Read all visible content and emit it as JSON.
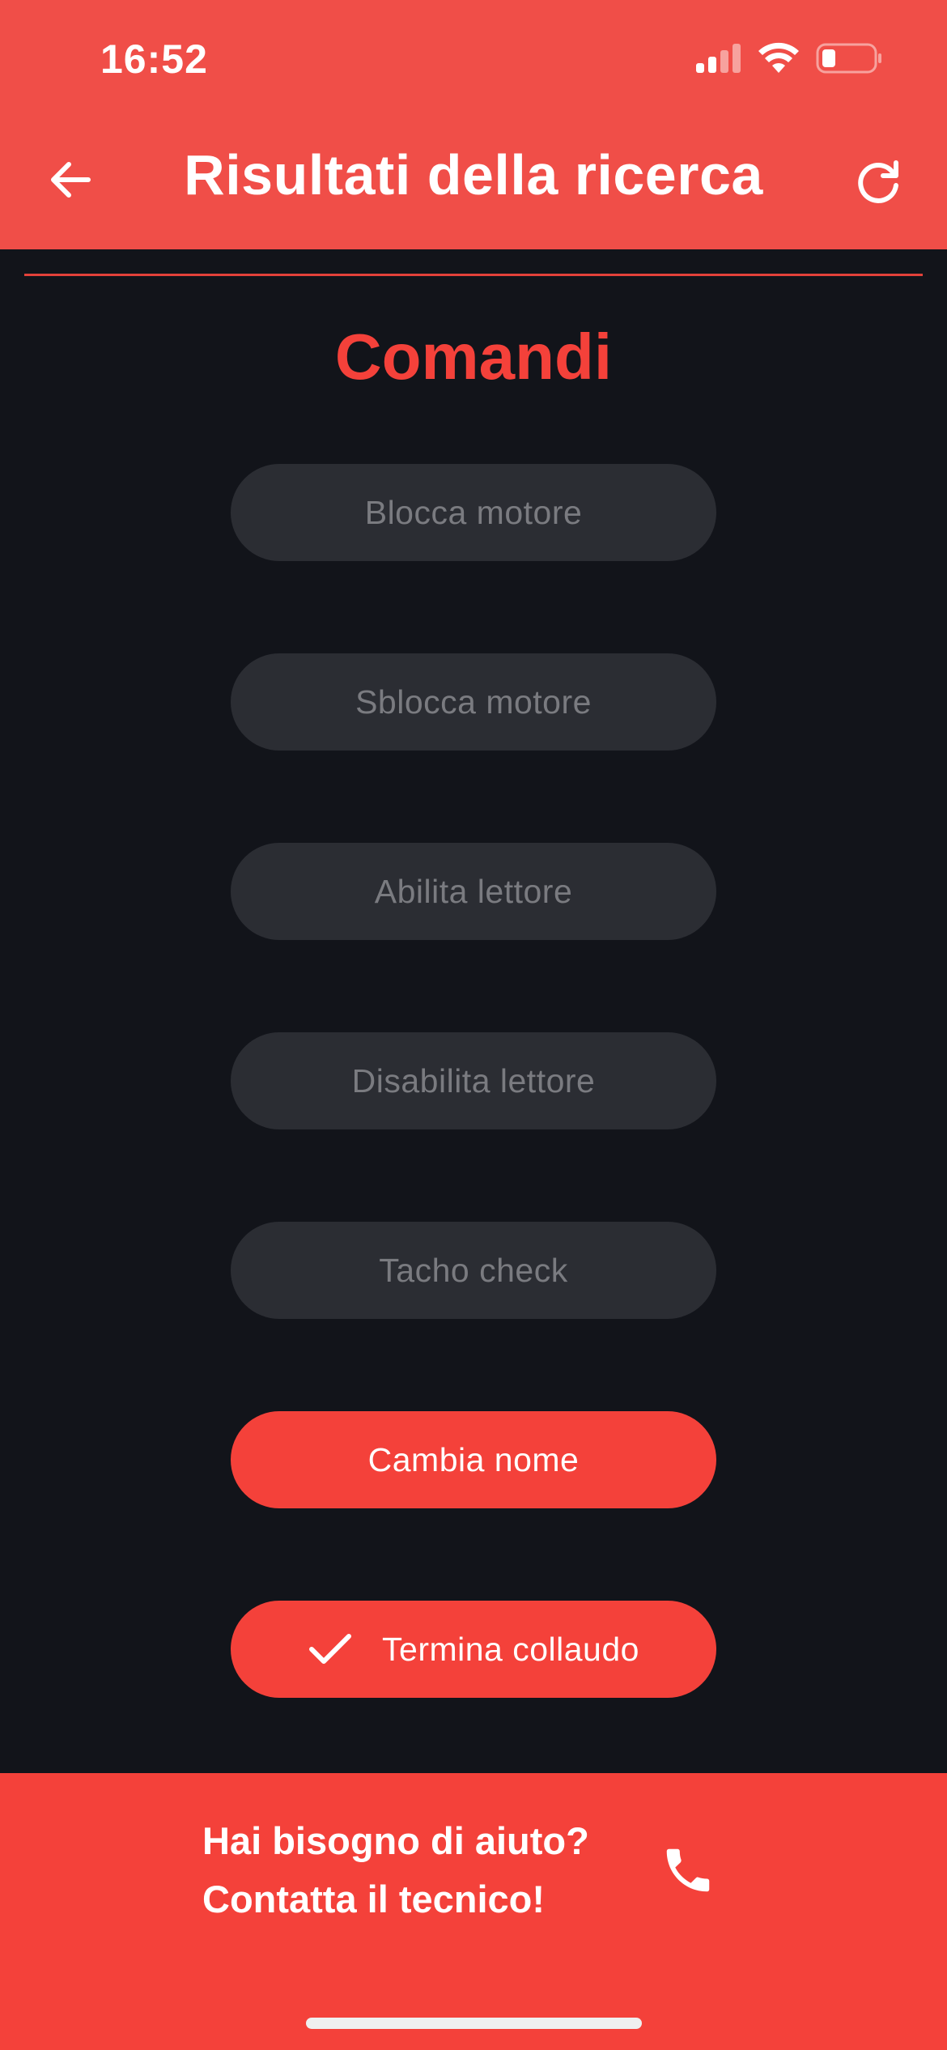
{
  "status_bar": {
    "time": "16:52"
  },
  "header": {
    "title": "Risultati della ricerca"
  },
  "section": {
    "title": "Comandi"
  },
  "buttons": [
    {
      "label": "Blocca motore",
      "state": "disabled"
    },
    {
      "label": "Sblocca motore",
      "state": "disabled"
    },
    {
      "label": "Abilita lettore",
      "state": "disabled"
    },
    {
      "label": "Disabilita lettore",
      "state": "disabled"
    },
    {
      "label": "Tacho check",
      "state": "disabled"
    },
    {
      "label": "Cambia nome",
      "state": "enabled"
    },
    {
      "label": "Termina collaudo",
      "state": "enabled",
      "icon": "check-icon"
    }
  ],
  "footer": {
    "help_line1": "Hai bisogno di aiuto?",
    "help_line2": "Contatta il tecnico!"
  },
  "colors": {
    "header_red": "#f04e48",
    "accent_red": "#f4413a",
    "background": "#12141a",
    "disabled_button": "#2b2d33",
    "disabled_text": "#7a7b80"
  },
  "icons": {
    "back": "arrow-left-icon",
    "refresh": "refresh-icon",
    "phone": "phone-icon",
    "signal": "cellular-signal-icon",
    "wifi": "wifi-icon",
    "battery": "battery-icon"
  }
}
